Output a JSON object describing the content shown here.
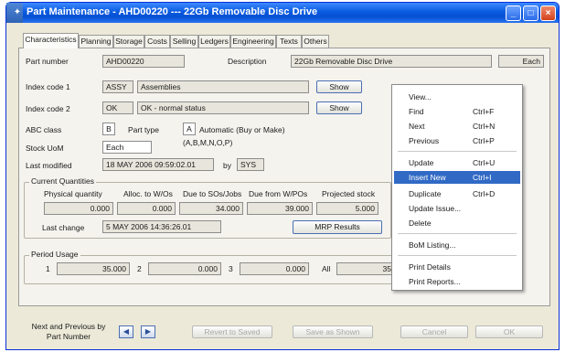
{
  "window": {
    "title": "Part Maintenance - AHD00220 --- 22Gb Removable Disc Drive",
    "minimize_icon": "minimize-icon",
    "maximize_icon": "maximize-icon",
    "close_icon": "close-icon"
  },
  "tabs": [
    "Characteristics",
    "Planning",
    "Storage",
    "Costs",
    "Selling",
    "Ledgers",
    "Engineering",
    "Texts",
    "Others"
  ],
  "header": {
    "part_number_label": "Part number",
    "part_number_value": "AHD00220",
    "description_label": "Description",
    "description_value": "22Gb Removable Disc Drive",
    "uom_value": "Each"
  },
  "index": {
    "code1_label": "Index code 1",
    "code1_value": "ASSY",
    "code1_desc": "Assemblies",
    "code2_label": "Index code 2",
    "code2_value": "OK",
    "code2_desc": "OK - normal status",
    "show_label": "Show"
  },
  "attributes": {
    "abc_label": "ABC class",
    "abc_value": "B",
    "part_type_label": "Part type",
    "part_type_value": "A",
    "part_type_desc": "Automatic (Buy or Make)",
    "part_type_options": "(A,B,M,N,O,P)",
    "stock_uom_label": "Stock UoM",
    "stock_uom_value": "Each",
    "last_modified_label": "Last modified",
    "last_modified_value": "18 MAY 2006  09:59:02.01",
    "by_label": "by",
    "by_value": "SYS"
  },
  "quantities": {
    "group_title": "Current Quantities",
    "headers": [
      "Physical quantity",
      "Alloc. to W/Os",
      "Due to SOs/Jobs",
      "Due from W/POs",
      "Projected stock"
    ],
    "values": [
      "0.000",
      "0.000",
      "34.000",
      "39.000",
      "5.000"
    ],
    "last_change_label": "Last change",
    "last_change_value": "5 MAY 2006  14:36:26.01",
    "mrp_results_label": "MRP Results"
  },
  "usage": {
    "group_title": "Period Usage",
    "p1_label": "1",
    "p1_value": "35.000",
    "p2_label": "2",
    "p2_value": "0.000",
    "p3_label": "3",
    "p3_value": "0.000",
    "all_label": "All",
    "all_value": "35"
  },
  "context_menu": {
    "items": [
      {
        "label": "View...",
        "shortcut": ""
      },
      {
        "label": "Find",
        "shortcut": "Ctrl+F"
      },
      {
        "label": "Next",
        "shortcut": "Ctrl+N"
      },
      {
        "label": "Previous",
        "shortcut": "Ctrl+P"
      },
      {
        "label": "Update",
        "shortcut": "Ctrl+U"
      },
      {
        "label": "Insert New",
        "shortcut": "Ctrl+I"
      },
      {
        "label": "Duplicate",
        "shortcut": "Ctrl+D"
      },
      {
        "label": "Update Issue...",
        "shortcut": ""
      },
      {
        "label": "Delete",
        "shortcut": ""
      },
      {
        "label": "BoM Listing...",
        "shortcut": ""
      },
      {
        "label": "Print Details",
        "shortcut": ""
      },
      {
        "label": "Print Reports...",
        "shortcut": ""
      }
    ],
    "highlight_color": "#316ac5"
  },
  "footer": {
    "nav_label_line1": "Next and Previous by",
    "nav_label_line2": "Part Number",
    "prev_icon": "arrow-left-icon",
    "next_icon": "arrow-right-icon",
    "revert_label": "Revert to Saved",
    "save_label": "Save as Shown",
    "cancel_label": "Cancel",
    "ok_label": "OK"
  }
}
